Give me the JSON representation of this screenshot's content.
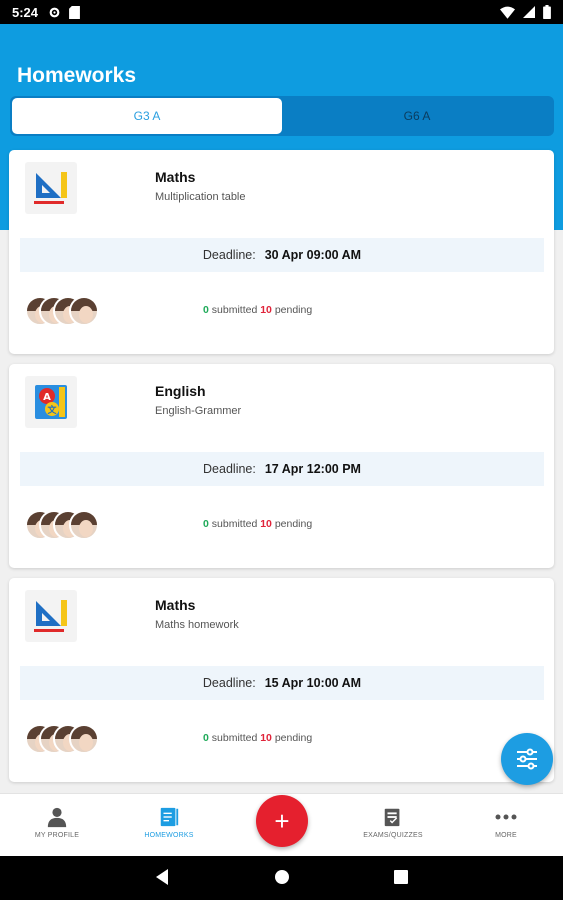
{
  "status_bar": {
    "time": "5:24"
  },
  "header": {
    "title": "Homeworks"
  },
  "tabs": [
    {
      "label": "G3 A",
      "active": true
    },
    {
      "label": "G6 A",
      "active": false
    }
  ],
  "homeworks": [
    {
      "subject": "Maths",
      "description": "Multiplication table",
      "icon": "maths-set-square-icon",
      "deadline_label": "Deadline:",
      "deadline": "30 Apr 09:00 AM",
      "submitted": "0",
      "submitted_label": "submitted",
      "pending": "10",
      "pending_label": "pending"
    },
    {
      "subject": "English",
      "description": "English-Grammer",
      "icon": "english-alphabet-book-icon",
      "deadline_label": "Deadline:",
      "deadline": "17 Apr 12:00 PM",
      "submitted": "0",
      "submitted_label": "submitted",
      "pending": "10",
      "pending_label": "pending"
    },
    {
      "subject": "Maths",
      "description": "Maths homework",
      "icon": "maths-set-square-icon",
      "deadline_label": "Deadline:",
      "deadline": "15 Apr 10:00 AM",
      "submitted": "0",
      "submitted_label": "submitted",
      "pending": "10",
      "pending_label": "pending"
    }
  ],
  "bottom_nav": [
    {
      "label": "MY PROFILE",
      "icon": "person-icon",
      "active": false
    },
    {
      "label": "HOMEWORKS",
      "icon": "homework-book-icon",
      "active": true
    },
    {
      "label": "EXAMS/QUIZZES",
      "icon": "exam-clipboard-icon",
      "active": false
    },
    {
      "label": "MORE",
      "icon": "more-dots-icon",
      "active": false
    }
  ],
  "colors": {
    "primary": "#0e9ce0",
    "add_button": "#e5202e",
    "submitted": "#1faa59",
    "pending": "#e0243a",
    "active_nav": "#1d9de2"
  }
}
